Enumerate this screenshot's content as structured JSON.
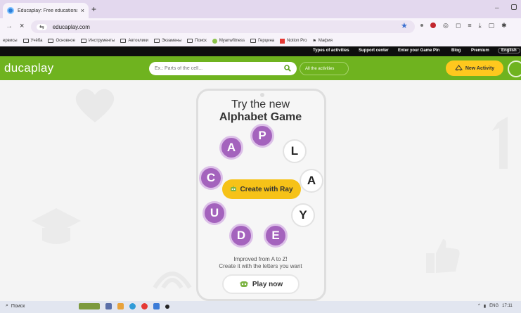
{
  "browser": {
    "tab_title": "Educaplay: Free educational ga",
    "tab_close": "×",
    "new_tab": "+",
    "window_min": "–",
    "url": "educaplay.com",
    "nav_forward": "→",
    "nav_close": "×",
    "site_info": "⇆"
  },
  "bookmarks": [
    {
      "label": "ервисы",
      "folder": false
    },
    {
      "label": "Учёба",
      "folder": true
    },
    {
      "label": "Основное",
      "folder": true
    },
    {
      "label": "Инструменты",
      "folder": true
    },
    {
      "label": "Автоклики",
      "folder": true
    },
    {
      "label": "Экзамены",
      "folder": true
    },
    {
      "label": "Поиск",
      "folder": true
    },
    {
      "label": "Myanwfitness",
      "folder": false
    },
    {
      "label": "Герцина",
      "folder": true
    },
    {
      "label": "Notion Pro",
      "folder": false
    },
    {
      "label": "Мафия",
      "folder": false
    }
  ],
  "topnav": {
    "types": "Types of activities",
    "support": "Support center",
    "game_pin": "Enter your Game Pin",
    "blog": "Blog",
    "premium": "Premium",
    "lang": "English"
  },
  "header": {
    "logo": "ducaplay",
    "search_placeholder": "Ex.: Parts of the cell...",
    "all_activities": "All the activities",
    "new_activity": "New Activity"
  },
  "promo": {
    "line1": "Try the new",
    "line2": "Alphabet Game",
    "letters": [
      "A",
      "P",
      "L",
      "C",
      "A",
      "U",
      "Y",
      "D",
      "E"
    ],
    "create_button": "Create with Ray",
    "improved_line1": "Improved from A to Z!",
    "improved_line2": "Create it with the letters you want",
    "play_button": "Play now"
  },
  "taskbar": {
    "search": "Поиск",
    "lang": "ENG",
    "time": "17:11"
  },
  "colors": {
    "brand_green": "#6fb31f",
    "accent_yellow": "#ffc81e",
    "letter_purple": "#a463bd"
  }
}
